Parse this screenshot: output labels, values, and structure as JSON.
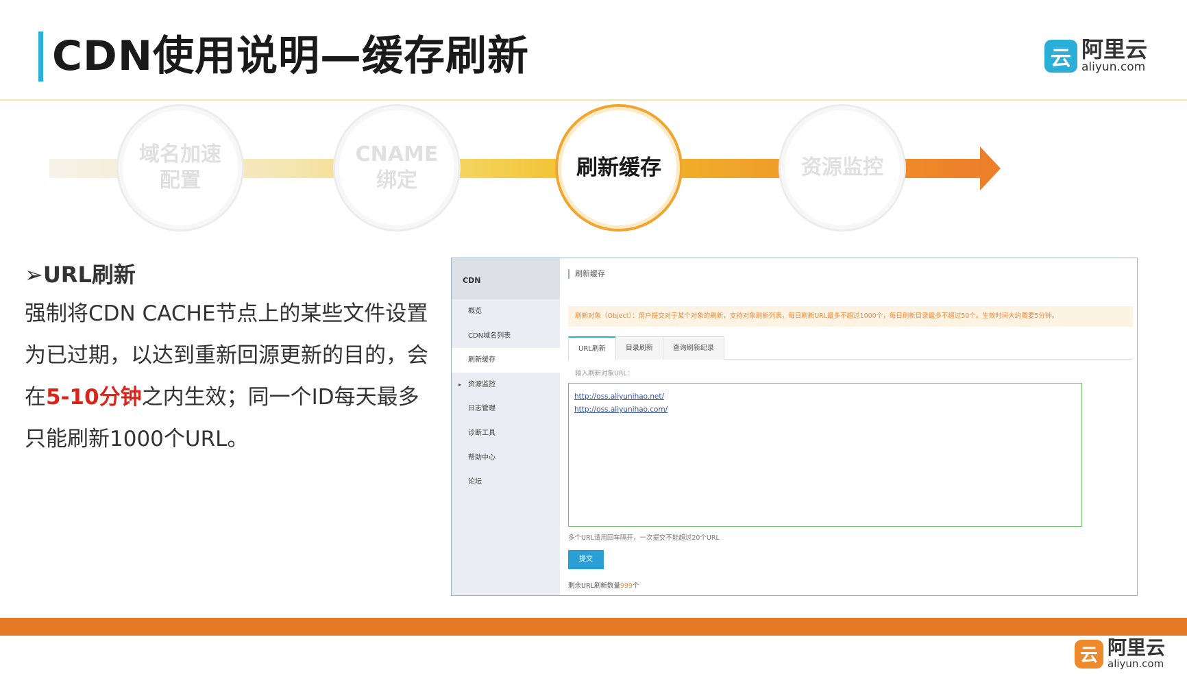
{
  "header": {
    "title": "CDN使用说明—缓存刷新",
    "logo": {
      "cn": "阿里云",
      "en": "aliyun.com",
      "mark_glyph": "云"
    }
  },
  "flow": {
    "steps": [
      {
        "label": "域名加速配置",
        "active": false
      },
      {
        "label": "CNAME绑定",
        "active": false
      },
      {
        "label": "刷新缓存",
        "active": true
      },
      {
        "label": "资源监控",
        "active": false
      }
    ]
  },
  "content": {
    "bullet_title": "➢URL刷新",
    "body_part1": "强制将CDN CACHE节点上的某些文件设置为已过期，以达到重新回源更新的目的，会在",
    "body_highlight": "5-10分钟",
    "body_part2": "之内生效；同一个ID每天最多只能刷新1000个URL。"
  },
  "console": {
    "sidebar": {
      "title": "CDN",
      "items": [
        {
          "label": "概览",
          "active": false,
          "caret": ""
        },
        {
          "label": "CDN域名列表",
          "active": false,
          "caret": ""
        },
        {
          "label": "刷新缓存",
          "active": true,
          "caret": ""
        },
        {
          "label": "资源监控",
          "active": false,
          "caret": "▸"
        },
        {
          "label": "日志管理",
          "active": false,
          "caret": ""
        },
        {
          "label": "诊断工具",
          "active": false,
          "caret": ""
        },
        {
          "label": "帮助中心",
          "active": false,
          "caret": ""
        },
        {
          "label": "论坛",
          "active": false,
          "caret": ""
        }
      ]
    },
    "page_title": "刷新缓存",
    "notice": "刷新对象（Object）：用户提交对于某个对象的刷新，支持对象刷新列表，每日刷新URL最多不超过1000个，每日刷新目录最多不超过50个。生效时间大约需要5分钟。",
    "tabs": [
      {
        "label": "URL刷新",
        "active": true
      },
      {
        "label": "目录刷新",
        "active": false
      },
      {
        "label": "查询刷新纪录",
        "active": false
      }
    ],
    "input_label": "输入刷新对象URL：",
    "urls": [
      "http://oss.aliyunihao.net/",
      "http://oss.aliyunihao.com/"
    ],
    "hint": "多个URL请用回车隔开，一次提交不能超过20个URL",
    "submit_label": "提交",
    "remain_prefix": "剩余URL刷新数量",
    "remain_count": "999",
    "remain_suffix": "个"
  },
  "colors": {
    "accent_blue": "#2ab0d8",
    "accent_orange": "#e77a24",
    "highlight_red": "#d9261c"
  }
}
